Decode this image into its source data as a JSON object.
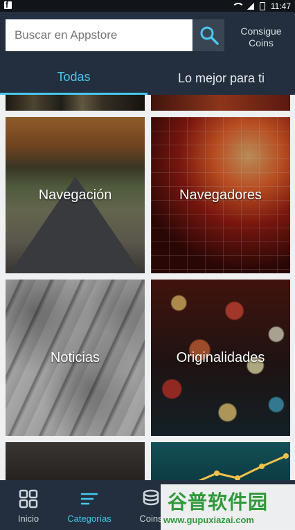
{
  "status_bar": {
    "time": "11:47"
  },
  "header": {
    "search": {
      "placeholder": "Buscar en Appstore",
      "value": ""
    },
    "coins_link": {
      "line1": "Consigue",
      "line2": "Coins"
    },
    "tabs": [
      {
        "label": "Todas",
        "selected": true
      },
      {
        "label": "Lo mejor para ti",
        "selected": false
      }
    ]
  },
  "categories": [
    {
      "label": "Navegación"
    },
    {
      "label": "Navegadores"
    },
    {
      "label": "Noticias"
    },
    {
      "label": "Originalidades"
    }
  ],
  "bottom_nav": [
    {
      "label": "Inicio",
      "icon": "grid-icon",
      "selected": false
    },
    {
      "label": "Categorías",
      "icon": "menu-lines-icon",
      "selected": true
    },
    {
      "label": "Coins",
      "icon": "coins-icon",
      "selected": false
    }
  ],
  "watermark": {
    "title": "谷普软件园",
    "url": "www.gupuxiazai.com"
  },
  "colors": {
    "header_bg": "#232f3e",
    "accent": "#48c8ef",
    "content_bg": "#eef0f1"
  }
}
